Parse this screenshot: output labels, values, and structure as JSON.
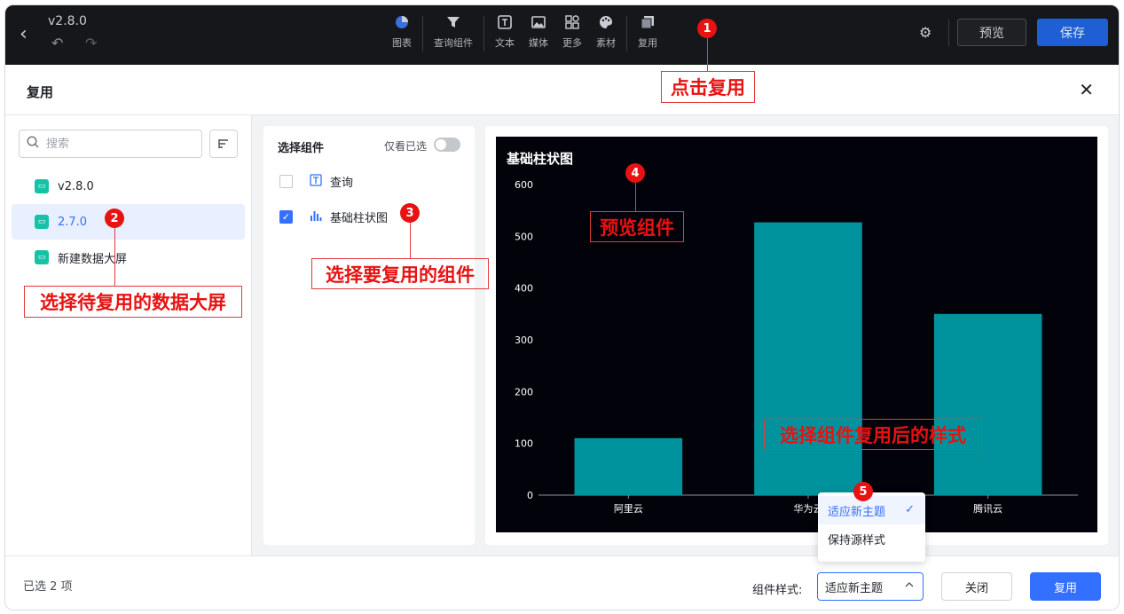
{
  "topbar": {
    "version": "v2.8.0",
    "tools": [
      {
        "label": "图表",
        "icon": "pie-chart-icon"
      },
      {
        "label": "查询组件",
        "icon": "filter-icon"
      },
      {
        "label": "文本",
        "icon": "text-icon"
      },
      {
        "label": "媒体",
        "icon": "image-icon"
      },
      {
        "label": "更多",
        "icon": "grid-icon"
      },
      {
        "label": "素材",
        "icon": "palette-icon"
      },
      {
        "label": "复用",
        "icon": "copy-icon"
      }
    ],
    "preview_label": "预览",
    "save_label": "保存"
  },
  "dialog": {
    "title": "复用",
    "search_placeholder": "搜索",
    "screens": [
      {
        "label": "v2.8.0",
        "selected": false
      },
      {
        "label": "2.7.0",
        "selected": true
      },
      {
        "label": "新建数据大屏",
        "selected": false
      }
    ],
    "components_title": "选择组件",
    "only_selected_label": "仅看已选",
    "components": [
      {
        "label": "查询",
        "checked": false,
        "icon": "text-box-icon"
      },
      {
        "label": "基础柱状图",
        "checked": true,
        "icon": "bar-chart-icon"
      }
    ],
    "selected_count": "已选 2 项",
    "style_label": "组件样式:",
    "style_value": "适应新主题",
    "style_options": [
      "适应新主题",
      "保持源样式"
    ],
    "close_label": "关闭",
    "reuse_label": "复用"
  },
  "annotations": {
    "a1": "点击复用",
    "a2": "选择待复用的数据大屏",
    "a3": "选择要复用的组件",
    "a4": "预览组件",
    "a5": "选择组件复用后的样式",
    "nums": [
      "1",
      "2",
      "3",
      "4",
      "5"
    ]
  },
  "chart_data": {
    "type": "bar",
    "title": "基础柱状图",
    "categories": [
      "阿里云",
      "华为云",
      "腾讯云"
    ],
    "values": [
      110,
      527,
      350
    ],
    "ylim": [
      0,
      600
    ],
    "yticks": [
      0,
      100,
      200,
      300,
      400,
      500,
      600
    ],
    "bar_color": "#00939d",
    "background": "#02030a",
    "grid": false
  }
}
